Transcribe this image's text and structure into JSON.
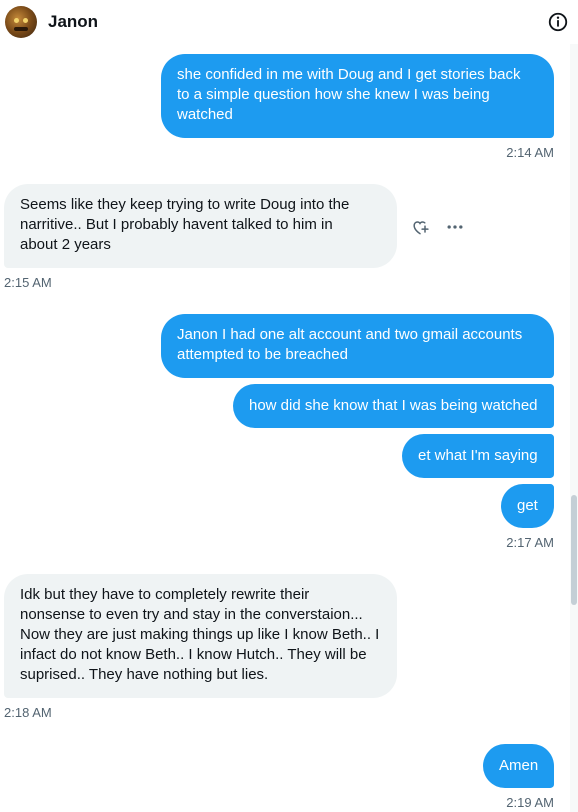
{
  "header": {
    "contact_name": "Janon"
  },
  "icons": {
    "avatar": "avatar-image",
    "info": "info-icon",
    "react": "heart-plus-icon",
    "more": "more-horizontal-icon"
  },
  "colors": {
    "outgoing_bubble": "#1d9bf0",
    "incoming_bubble": "#eff3f4",
    "timestamp": "#536471"
  },
  "messages": [
    {
      "direction": "out",
      "text": "she confided in me with Doug and I get stories back\nto a simple question how she knew I was being\nwatched"
    },
    {
      "direction": "in",
      "text": "Seems like they keep trying to write Doug into the\nnarritive..  But I probably havent talked to him in\nabout 2 years"
    },
    {
      "direction": "out",
      "text": "Janon I had one alt account and two gmail accounts\nattempted to be breached"
    },
    {
      "direction": "out",
      "text": "how did she know that I was being watched"
    },
    {
      "direction": "out",
      "text": "et what I'm saying"
    },
    {
      "direction": "out",
      "text": "get"
    },
    {
      "direction": "in",
      "text": "Idk but they have to completely rewrite their\nnonsense to even try and stay in the converstaion...\nNow they are just making things up like I know Beth.. I\ninfact do not know Beth.. I know Hutch.. They will be\nsuprised.. They have nothing but lies."
    },
    {
      "direction": "out",
      "text": "Amen"
    }
  ],
  "timestamps": [
    "2:14 AM",
    "2:15 AM",
    "2:17 AM",
    "2:18 AM",
    "2:19 AM"
  ]
}
